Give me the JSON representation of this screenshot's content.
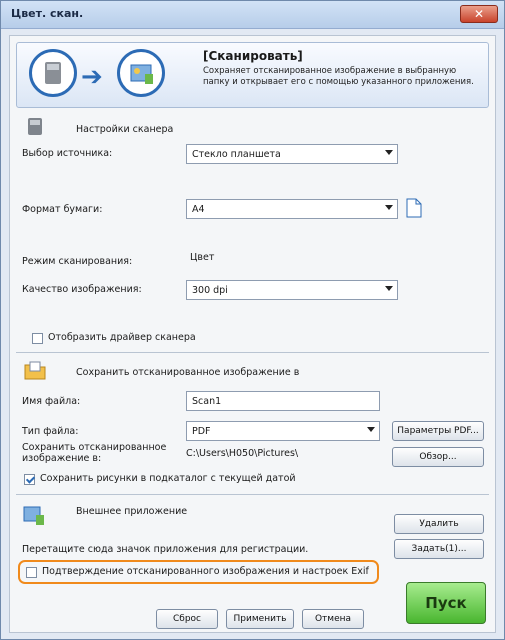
{
  "window": {
    "title": "Цвет. скан."
  },
  "banner": {
    "title": "[Сканировать]",
    "description": "Сохраняет отсканированное изображение в выбранную папку и открывает его с помощью указанного приложения."
  },
  "scanner": {
    "section_label": "Настройки сканера",
    "source_label": "Выбор источника:",
    "source_value": "Стекло планшета",
    "paper_label": "Формат бумаги:",
    "paper_value": "A4",
    "mode_label": "Режим сканирования:",
    "mode_value": "Цвет",
    "quality_label": "Качество изображения:",
    "quality_value": "300 dpi",
    "show_driver_label": "Отобразить драйвер сканера",
    "show_driver_checked": false
  },
  "save": {
    "section_label": "Сохранить отсканированное изображение в",
    "filename_label": "Имя файла:",
    "filename_value": "Scan1",
    "filetype_label": "Тип файла:",
    "filetype_value": "PDF",
    "pdf_params_button": "Параметры PDF...",
    "save_to_label": "Сохранить отсканированное изображение в:",
    "save_to_path": "C:\\Users\\H050\\Pictures\\",
    "browse_button": "Обзор...",
    "subfolder_label": "Сохранить рисунки в подкаталог с текущей датой",
    "subfolder_checked": true
  },
  "app": {
    "section_label": "Внешнее приложение",
    "remove_button": "Удалить",
    "drag_hint": "Перетащите сюда значок приложения для регистрации.",
    "set_button": "Задать(1)..."
  },
  "footer": {
    "confirm_label": "Подтверждение отсканированного изображения и настроек Exif",
    "confirm_checked": false,
    "reset_button": "Сброс",
    "apply_button": "Применить",
    "cancel_button": "Отмена",
    "start_button": "Пуск"
  }
}
